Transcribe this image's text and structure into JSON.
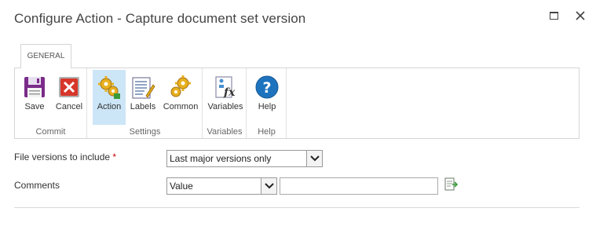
{
  "dialog": {
    "title": "Configure Action - Capture document set version"
  },
  "ribbon": {
    "tab_label": "GENERAL",
    "groups": [
      {
        "label": "Commit",
        "buttons": [
          {
            "label": "Save",
            "icon": "save-icon"
          },
          {
            "label": "Cancel",
            "icon": "cancel-icon"
          }
        ]
      },
      {
        "label": "Settings",
        "buttons": [
          {
            "label": "Action",
            "icon": "action-gears-icon",
            "selected": true
          },
          {
            "label": "Labels",
            "icon": "labels-icon"
          },
          {
            "label": "Common",
            "icon": "common-gears-icon"
          }
        ]
      },
      {
        "label": "Variables",
        "buttons": [
          {
            "label": "Variables",
            "icon": "variables-fx-icon"
          }
        ]
      },
      {
        "label": "Help",
        "buttons": [
          {
            "label": "Help",
            "icon": "help-icon"
          }
        ]
      }
    ]
  },
  "form": {
    "file_versions": {
      "label": "File versions to include",
      "required_marker": "*",
      "value": "Last major versions only"
    },
    "comments": {
      "label": "Comments",
      "type_value": "Value",
      "text_value": ""
    }
  },
  "colors": {
    "selected_button": "#cde6f7",
    "required": "#cc0000",
    "help_blue": "#1e73be"
  }
}
